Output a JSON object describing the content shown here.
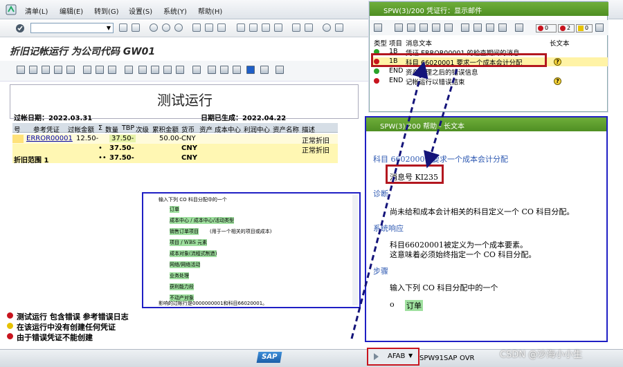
{
  "menubar": {
    "items": [
      "清单(L)",
      "编辑(E)",
      "转到(G)",
      "设置(S)",
      "系统(Y)",
      "帮助(H)"
    ]
  },
  "title": "折旧记帐运行 为公司代码 GW01",
  "report": {
    "heading": "测试运行",
    "date_left": "过帐日期：2022.03.31",
    "date_right": "日期已生成：2022.04.22"
  },
  "grid": {
    "headers": [
      "号",
      "参考凭证",
      "过帐金额",
      "Σ",
      "数量",
      "TBP",
      "次级",
      "累积金额",
      "货币",
      "资产",
      "成本中心",
      "利润中心",
      "资产名称",
      "描述"
    ],
    "rows": [
      {
        "ref": "ERROR00001",
        "amount": "12.50-",
        "qty": "37.50-",
        "accum": "50.00-",
        "curr": "CNY",
        "desc": "正常折旧"
      },
      {
        "ref": "",
        "marker": "•",
        "qty": "37.50-",
        "curr": "CNY",
        "desc": "正常折旧"
      },
      {
        "label": "折旧范围 1",
        "marker": "••",
        "qty": "37.50-",
        "curr": "CNY"
      }
    ]
  },
  "messages": [
    {
      "text": "测试运行 包含错误 参考错误日志",
      "color": "#c8141e"
    },
    {
      "text": "在该运行中没有创建任何凭证",
      "color": "#e6c200"
    },
    {
      "text": "由于错误凭证不能创建",
      "color": "#c8141e"
    }
  ],
  "msgwin": {
    "title": "SPW(3)/200 凭证行：显示邮件",
    "counts": {
      "red": "0",
      "red2": "2",
      "yellow": "0"
    },
    "headers": {
      "type": "类型",
      "item": "项目",
      "text": "消息文本",
      "long": "长文本"
    },
    "rows": [
      {
        "type_color": "#2aa32a",
        "item": "1B",
        "text": "凭证 ERROR00001 的检查期间的消息"
      },
      {
        "type_color": "#c8141e",
        "item": "1B",
        "text": "科目 66020001 要求一个成本会计分配"
      },
      {
        "type_color": "#2aa32a",
        "item": "END",
        "text": "资产处理之后的错误信息"
      },
      {
        "type_color": "#c8141e",
        "item": "END",
        "text": "记帐运行以错误结束"
      }
    ]
  },
  "helpwin": {
    "title": "SPW(3)/200 帮助 - 长文本",
    "heading": "科目 66020001 要求一个成本会计分配",
    "msgno": "消息号 KI235",
    "diag_title": "诊断",
    "diag_text": "尚未给和成本会计相关的科目定义一个 CO 科目分配。",
    "sys_title": "系统响应",
    "sys_text1": "科目66020001被定义为一个成本要素。",
    "sys_text2": "这意味着必须始终指定一个 CO 科目分配。",
    "steps_title": "步骤",
    "steps_text": "输入下列 CO 科目分配中的一个",
    "steps_item": "订单"
  },
  "popup": {
    "intro": "输入下列 CO 科目分配中的一个",
    "items": [
      "订单",
      "成本中心 / 成本中心/活动类型",
      "销售订单项目",
      "项目 / WBS 元素",
      "成本对象(流程式制造)",
      "网络/网络活动",
      "业务处理",
      "获利能力段",
      "不动产对象"
    ],
    "note": "(用于一个相关的项目或成本)",
    "footer": "影响的过帐行是0000000001和科目66020001。"
  },
  "statusbar": {
    "sap": "SAP",
    "tx": "AFAB",
    "system": "SPW91SAP",
    "mode": "OVR"
  },
  "watermark": "CSDN @沙海小小生"
}
